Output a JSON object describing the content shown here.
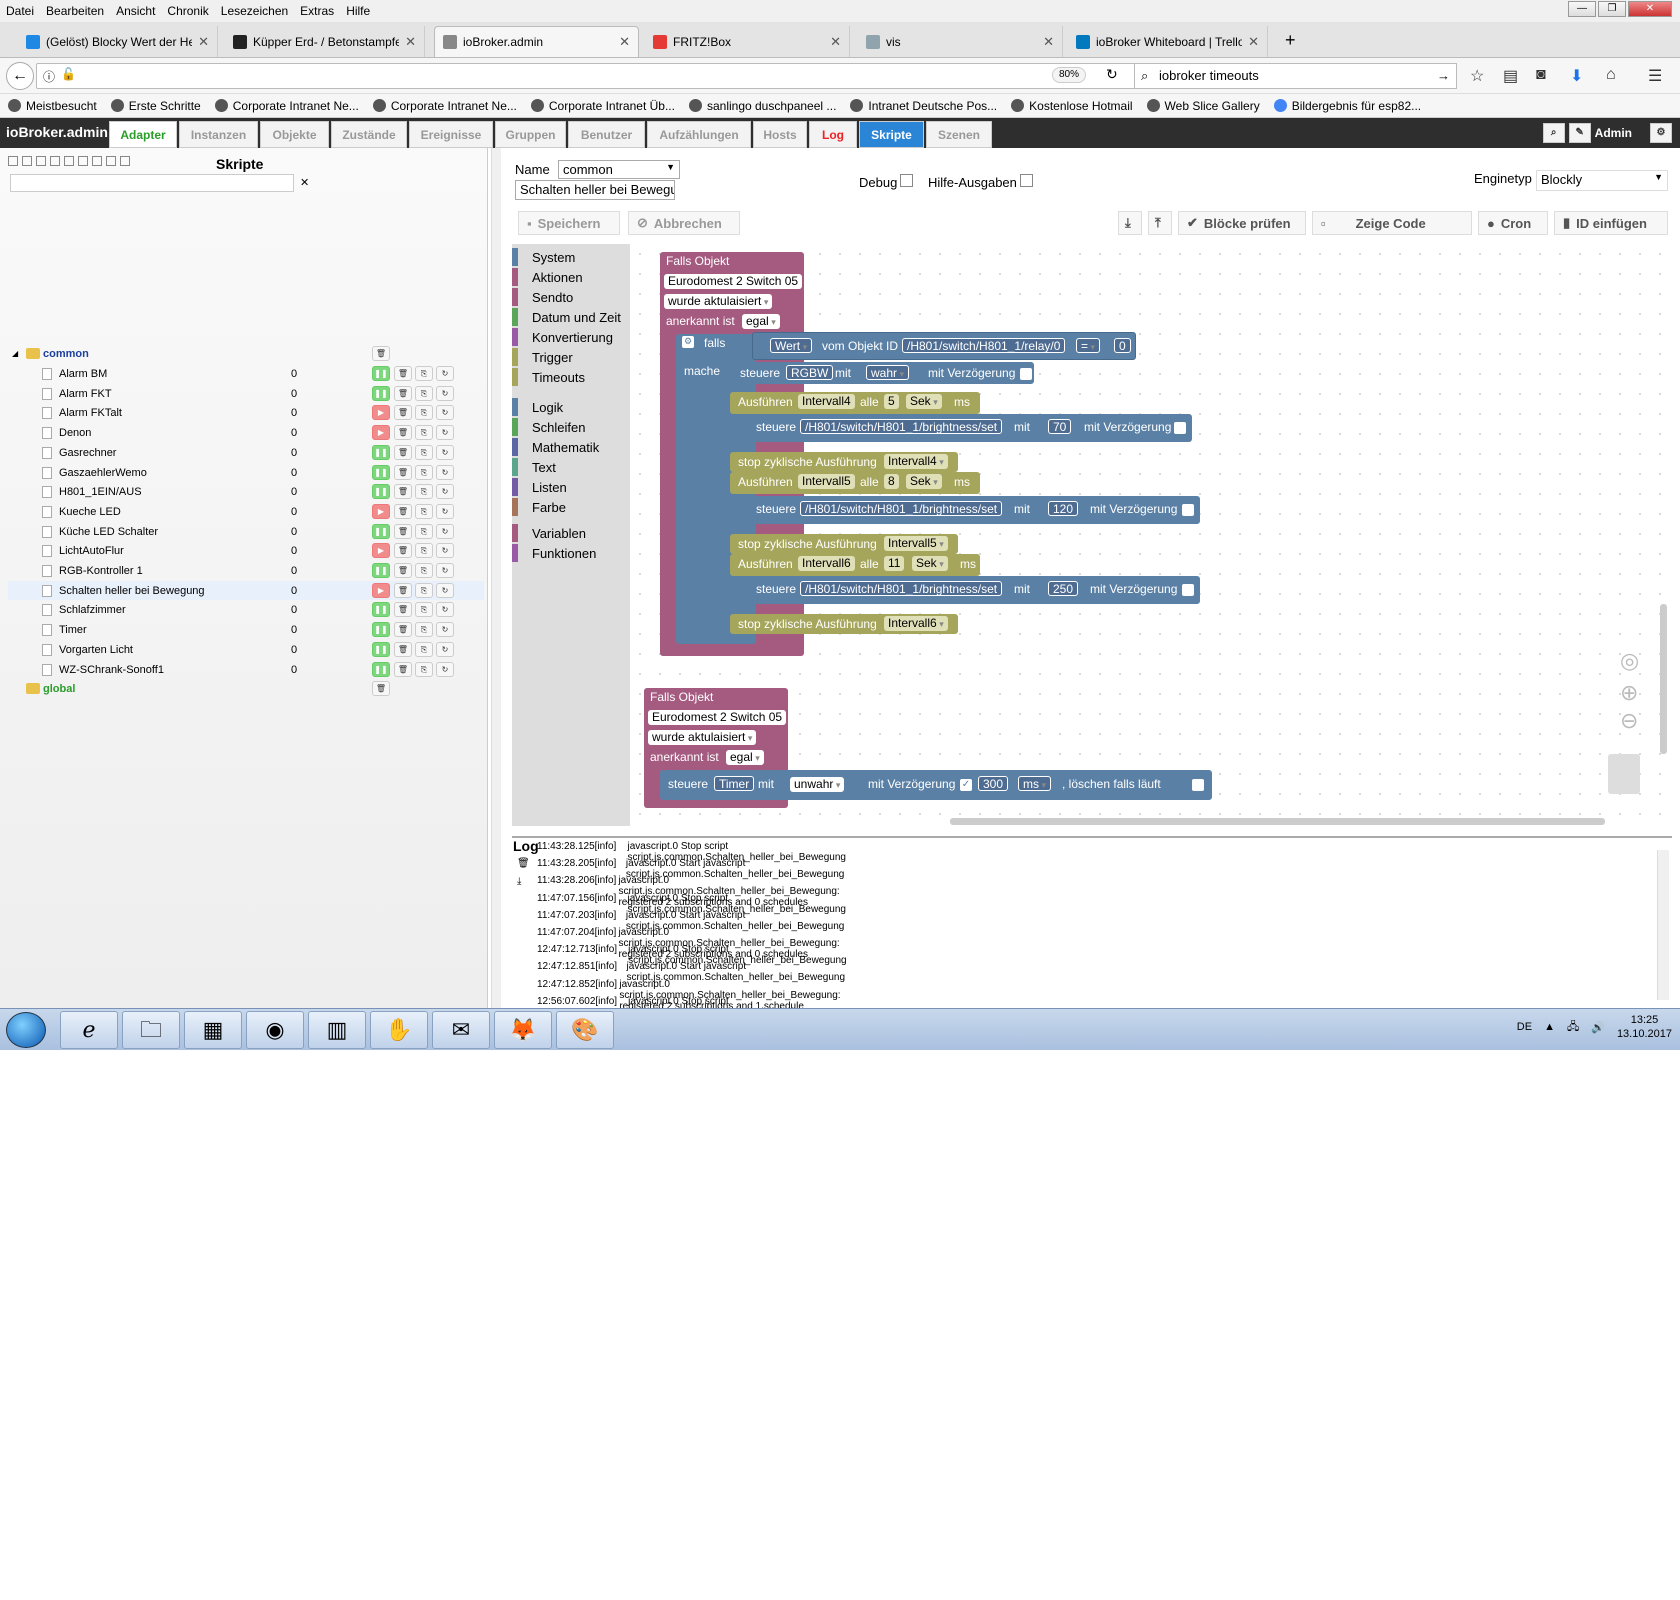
{
  "menu": [
    "Datei",
    "Bearbeiten",
    "Ansicht",
    "Chronik",
    "Lesezeichen",
    "Extras",
    "Hilfe"
  ],
  "browser_tabs": [
    {
      "title": "(Gelöst) Blocky Wert der Helli",
      "color": "#1e88e5"
    },
    {
      "title": "Küpper Erd- / Betonstampfer",
      "color": "#222"
    },
    {
      "title": "ioBroker.admin",
      "color": "#888"
    },
    {
      "title": "FRITZ!Box",
      "color": "#e53935"
    },
    {
      "title": "vis",
      "color": "#90a4ae"
    },
    {
      "title": "ioBroker Whiteboard | Trello",
      "color": "#0079bf"
    }
  ],
  "zoom": "80%",
  "search_value": "iobroker timeouts",
  "bookmarks": [
    "Meistbesucht",
    "Erste Schritte",
    "Corporate Intranet Ne...",
    "Corporate Intranet Ne...",
    "Corporate Intranet Üb...",
    "sanlingo duschpaneel ...",
    "Intranet Deutsche Pos...",
    "Kostenlose Hotmail",
    "Web Slice Gallery",
    "Bildergebnis für esp82..."
  ],
  "app": {
    "title": "ioBroker.admin",
    "tabs": [
      "Adapter",
      "Instanzen",
      "Objekte",
      "Zustände",
      "Ereignisse",
      "Gruppen",
      "Benutzer",
      "Aufzählungen",
      "Hosts",
      "Log",
      "Skripte",
      "Szenen"
    ],
    "user": "Admin"
  },
  "scripts_panel": {
    "title": "Skripte",
    "folder_common": "common",
    "folder_global": "global",
    "items": [
      {
        "name": "Alarm BM",
        "count": "0",
        "running": true
      },
      {
        "name": "Alarm FKT",
        "count": "0",
        "running": true
      },
      {
        "name": "Alarm FKTalt",
        "count": "0",
        "running": false
      },
      {
        "name": "Denon",
        "count": "0",
        "running": false
      },
      {
        "name": "Gasrechner",
        "count": "0",
        "running": true
      },
      {
        "name": "GaszaehlerWemo",
        "count": "0",
        "running": true
      },
      {
        "name": "H801_1EIN/AUS",
        "count": "0",
        "running": true
      },
      {
        "name": "Kueche LED",
        "count": "0",
        "running": false
      },
      {
        "name": "Küche LED Schalter",
        "count": "0",
        "running": true
      },
      {
        "name": "LichtAutoFlur",
        "count": "0",
        "running": false
      },
      {
        "name": "RGB-Kontroller 1",
        "count": "0",
        "running": true
      },
      {
        "name": "Schalten heller bei Bewegung",
        "count": "0",
        "running": false
      },
      {
        "name": "Schlafzimmer",
        "count": "0",
        "running": true
      },
      {
        "name": "Timer",
        "count": "0",
        "running": true
      },
      {
        "name": "Vorgarten Licht",
        "count": "0",
        "running": true
      },
      {
        "name": "WZ-SChrank-Sonoff1",
        "count": "0",
        "running": true
      }
    ]
  },
  "editor": {
    "name_label": "Name",
    "folder_value": "common",
    "script_name": "Schalten heller bei Bewegu",
    "debug_label": "Debug",
    "help_label": "Hilfe-Ausgaben",
    "engine_label": "Enginetyp",
    "engine_value": "Blockly",
    "save": "Speichern",
    "cancel": "Abbrechen",
    "check": "Blöcke prüfen",
    "show_code": "Zeige Code",
    "cron": "Cron",
    "insert_id": "ID einfügen"
  },
  "toolbox": [
    {
      "label": "System",
      "color": "#5b80a5"
    },
    {
      "label": "Aktionen",
      "color": "#a55b80"
    },
    {
      "label": "Sendto",
      "color": "#a55b80"
    },
    {
      "label": "Datum und Zeit",
      "color": "#5ba55b"
    },
    {
      "label": "Konvertierung",
      "color": "#995ba5"
    },
    {
      "label": "Trigger",
      "color": "#a5a55b"
    },
    {
      "label": "Timeouts",
      "color": "#a5a55b"
    },
    {
      "label": "Logik",
      "color": "#5b80a5"
    },
    {
      "label": "Schleifen",
      "color": "#5ba55b"
    },
    {
      "label": "Mathematik",
      "color": "#5b67a5"
    },
    {
      "label": "Text",
      "color": "#5ba58c"
    },
    {
      "label": "Listen",
      "color": "#745ba5"
    },
    {
      "label": "Farbe",
      "color": "#a5745b"
    },
    {
      "label": "Variablen",
      "color": "#a55b80"
    },
    {
      "label": "Funktionen",
      "color": "#995ba5"
    }
  ],
  "blocks": {
    "falls_objekt": "Falls Objekt",
    "device": "Eurodomest 2 Switch 05",
    "updated": "wurde aktulaisiert",
    "ack": "anerkannt ist",
    "egal": "egal",
    "falls": "falls",
    "mache": "mache",
    "wert": "Wert",
    "vom_objekt": "vom Objekt ID",
    "relay_id": "/H801/switch/H801_1/relay/0",
    "eq": "=",
    "zero": "0",
    "steuere": "steuere",
    "rgbw": "RGBW",
    "mit": "mit",
    "wahr": "wahr",
    "mit_verz": "mit Verzögerung",
    "ausfuehren": "Ausführen",
    "alle": "alle",
    "sek": "Sek",
    "ms": "ms",
    "brightness": "/H801/switch/H801_1/brightness/set",
    "stop": "stop zyklische Ausführung",
    "intervals": [
      {
        "name": "Intervall4",
        "every": "5",
        "value": "70"
      },
      {
        "name": "Intervall5",
        "every": "8",
        "value": "120"
      },
      {
        "name": "Intervall6",
        "every": "11",
        "value": "250"
      }
    ],
    "timer": "Timer",
    "unwahr": "unwahr",
    "delay": "300",
    "delete_if": ", löschen falls läuft"
  },
  "log": {
    "title": "Log",
    "rows": [
      {
        "time": "11:43:28.125",
        "level": "[info]",
        "msg": "javascript.0 Stop script script.js.common.Schalten_heller_bei_Bewegung"
      },
      {
        "time": "11:43:28.205",
        "level": "[info]",
        "msg": "javascript.0 Start javascript script.js.common.Schalten_heller_bei_Bewegung"
      },
      {
        "time": "11:43:28.206",
        "level": "[info]",
        "msg": "javascript.0 script.js.common.Schalten_heller_bei_Bewegung: registered 2 subscriptions and 0 schedules"
      },
      {
        "time": "11:47:07.156",
        "level": "[info]",
        "msg": "javascript.0 Stop script script.js.common.Schalten_heller_bei_Bewegung"
      },
      {
        "time": "11:47:07.203",
        "level": "[info]",
        "msg": "javascript.0 Start javascript script.js.common.Schalten_heller_bei_Bewegung"
      },
      {
        "time": "11:47:07.204",
        "level": "[info]",
        "msg": "javascript.0 script.js.common.Schalten_heller_bei_Bewegung: registered 2 subscriptions and 0 schedules"
      },
      {
        "time": "12:47:12.713",
        "level": "[info]",
        "msg": "javascript.0 Stop script script.js.common.Schalten_heller_bei_Bewegung"
      },
      {
        "time": "12:47:12.851",
        "level": "[info]",
        "msg": "javascript.0 Start javascript script.js.common.Schalten_heller_bei_Bewegung"
      },
      {
        "time": "12:47:12.852",
        "level": "[info]",
        "msg": "javascript.0 script.js.common.Schalten_heller_bei_Bewegung: registered 2 subscriptions and 1 schedule"
      },
      {
        "time": "12:56:07.602",
        "level": "[info]",
        "msg": "javascript.0 Stop script script.js.common.Schalten_heller_bei_Bewegung"
      }
    ]
  },
  "taskbar": {
    "lang": "DE",
    "time": "13:25",
    "date": "13.10.2017"
  }
}
